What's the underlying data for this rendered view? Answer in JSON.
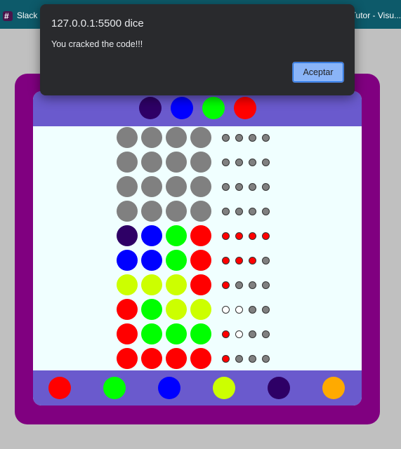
{
  "browser": {
    "tabs": [
      {
        "label": "Slack",
        "icon": "slack-icon"
      },
      {
        "label": "Tutor - Visu..."
      }
    ]
  },
  "alert": {
    "title": "127.0.0.1:5500 dice",
    "message": "You cracked the code!!!",
    "ok_label": "Aceptar"
  },
  "colors": {
    "frame": "#800080",
    "bar": "#6a5acd",
    "board_bg": "#f0ffff",
    "empty_peg": "#808080",
    "hint_exact": "#ff0000",
    "hint_color": "#ffffff",
    "hint_none": "#808080"
  },
  "game": {
    "secret_code": [
      "#2e0066",
      "#0000ff",
      "#00ff00",
      "#ff0000"
    ],
    "rows": [
      {
        "pegs": [
          "#808080",
          "#808080",
          "#808080",
          "#808080"
        ],
        "hints": [
          "none",
          "none",
          "none",
          "none"
        ]
      },
      {
        "pegs": [
          "#808080",
          "#808080",
          "#808080",
          "#808080"
        ],
        "hints": [
          "none",
          "none",
          "none",
          "none"
        ]
      },
      {
        "pegs": [
          "#808080",
          "#808080",
          "#808080",
          "#808080"
        ],
        "hints": [
          "none",
          "none",
          "none",
          "none"
        ]
      },
      {
        "pegs": [
          "#808080",
          "#808080",
          "#808080",
          "#808080"
        ],
        "hints": [
          "none",
          "none",
          "none",
          "none"
        ]
      },
      {
        "pegs": [
          "#2e0066",
          "#0000ff",
          "#00ff00",
          "#ff0000"
        ],
        "hints": [
          "exact",
          "exact",
          "exact",
          "exact"
        ]
      },
      {
        "pegs": [
          "#0000ff",
          "#0000ff",
          "#00ff00",
          "#ff0000"
        ],
        "hints": [
          "exact",
          "exact",
          "exact",
          "none"
        ]
      },
      {
        "pegs": [
          "#ccff00",
          "#ccff00",
          "#ccff00",
          "#ff0000"
        ],
        "hints": [
          "exact",
          "none",
          "none",
          "none"
        ]
      },
      {
        "pegs": [
          "#ff0000",
          "#00ff00",
          "#ccff00",
          "#ccff00"
        ],
        "hints": [
          "color",
          "color",
          "none",
          "none"
        ]
      },
      {
        "pegs": [
          "#ff0000",
          "#00ff00",
          "#00ff00",
          "#00ff00"
        ],
        "hints": [
          "exact",
          "color",
          "none",
          "none"
        ]
      },
      {
        "pegs": [
          "#ff0000",
          "#ff0000",
          "#ff0000",
          "#ff0000"
        ],
        "hints": [
          "exact",
          "none",
          "none",
          "none"
        ]
      }
    ],
    "palette": [
      "#ff0000",
      "#00ff00",
      "#0000ff",
      "#ccff00",
      "#2e0066",
      "#ffaa00"
    ]
  }
}
